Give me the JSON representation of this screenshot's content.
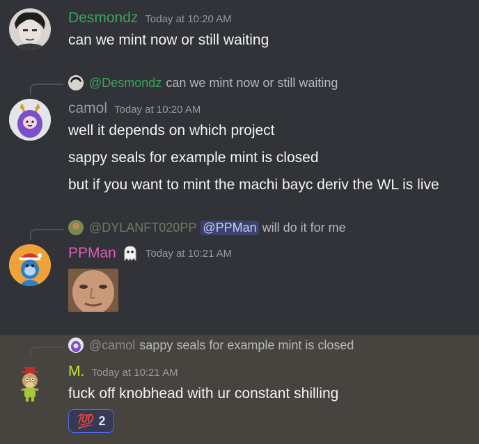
{
  "messages": [
    {
      "author": "Desmondz",
      "author_color": "#3ba55c",
      "timestamp": "Today at 10:20 AM",
      "lines": [
        "can we mint now or still waiting"
      ]
    },
    {
      "reply": {
        "author": "@Desmondz",
        "text": "can we mint now or still waiting"
      },
      "author": "camol",
      "author_color": "#949ba4",
      "timestamp": "Today at 10:20 AM",
      "lines": [
        "well it depends on which project",
        "sappy seals for example mint is closed",
        "but if you want to mint the machi bayc deriv the WL is live"
      ]
    },
    {
      "reply": {
        "author": "@DYLANFT020PP",
        "mention": "@PPMan",
        "text": "will do it for me"
      },
      "author": "PPMan",
      "author_color": "#e05fb8",
      "timestamp": "Today at 10:21 AM",
      "author_badge_icon": "ghost-emoji-icon"
    },
    {
      "reply": {
        "author": "@camol",
        "text": "sappy seals for example mint is closed"
      },
      "author": "M.",
      "author_color": "#c1e830",
      "timestamp": "Today at 10:21 AM",
      "lines": [
        "fuck off knobhead with ur constant shilling"
      ],
      "reaction": {
        "icon": "100-emoji-icon",
        "glyph": "💯",
        "count": "2"
      }
    }
  ]
}
